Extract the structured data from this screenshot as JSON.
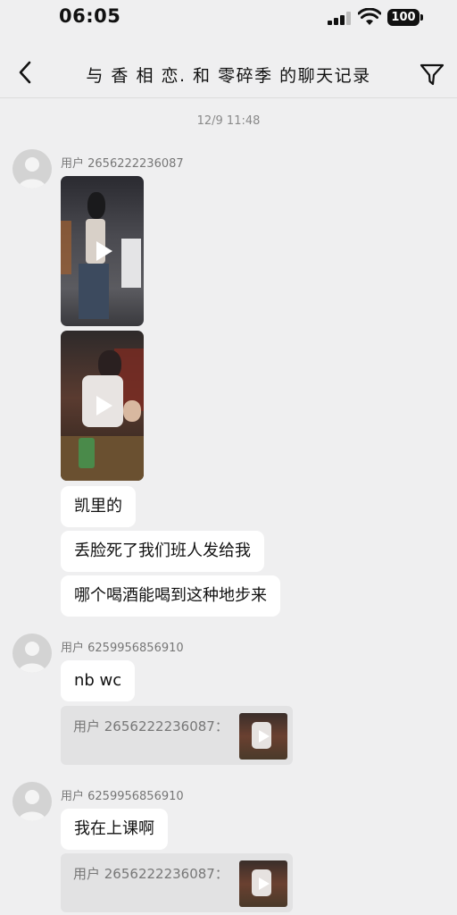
{
  "status_bar": {
    "time": "06:05",
    "battery": "100"
  },
  "header": {
    "title": "与 香 相 恋. 和 零碎季 的聊天记录"
  },
  "chat": {
    "timestamp": "12/9 11:48",
    "user_a": "用户 2656222236087",
    "user_b": "用户 6259956856910",
    "msg1": "凯里的",
    "msg2": "丢脸死了我们班人发给我",
    "msg3": "哪个喝酒能喝到这种地步来",
    "msg4": "nb wc",
    "msg5": "我在上课啊",
    "quote_label": "用户 2656222236087："
  }
}
